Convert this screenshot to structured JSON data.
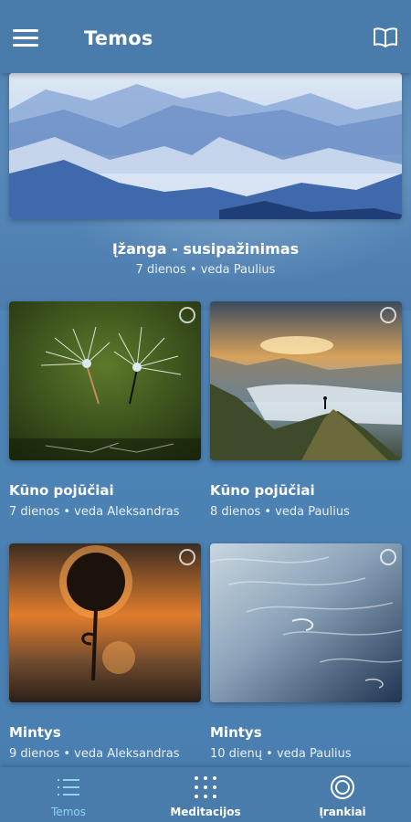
{
  "header": {
    "title": "Temos",
    "menu_icon": "hamburger-menu-icon",
    "right_icon": "open-book-icon"
  },
  "featured": {
    "title": "Įžanga - susipažinimas",
    "subtitle": "7 dienos • veda Paulius",
    "image": "misty-mountains"
  },
  "cards": [
    {
      "title": "Kūno pojūčiai",
      "subtitle": "7 dienos • veda Aleksandras",
      "image": "dandelion-seeds-water-drops"
    },
    {
      "title": "Kūno pojūčiai",
      "subtitle": "8 dienos • veda Paulius",
      "image": "hiker-on-mountain-ridge-sunrise"
    },
    {
      "title": "Mintys",
      "subtitle": "9 dienos • veda Aleksandras",
      "image": "dandelion-silhouette-sunset"
    },
    {
      "title": "Mintys",
      "subtitle": "10 dienų • veda Paulius",
      "image": "ocean-waves-aerial"
    }
  ],
  "bottom_nav": {
    "items": [
      {
        "label": "Temos",
        "icon": "list-icon",
        "active": true
      },
      {
        "label": "Meditacijos",
        "icon": "dots-grid-icon",
        "active": false
      },
      {
        "label": "Įrankiai",
        "icon": "target-circle-icon",
        "active": false
      }
    ]
  },
  "colors": {
    "header_bg": "#4a7cab",
    "active_nav": "#8fd4f0",
    "text": "#ffffff"
  }
}
